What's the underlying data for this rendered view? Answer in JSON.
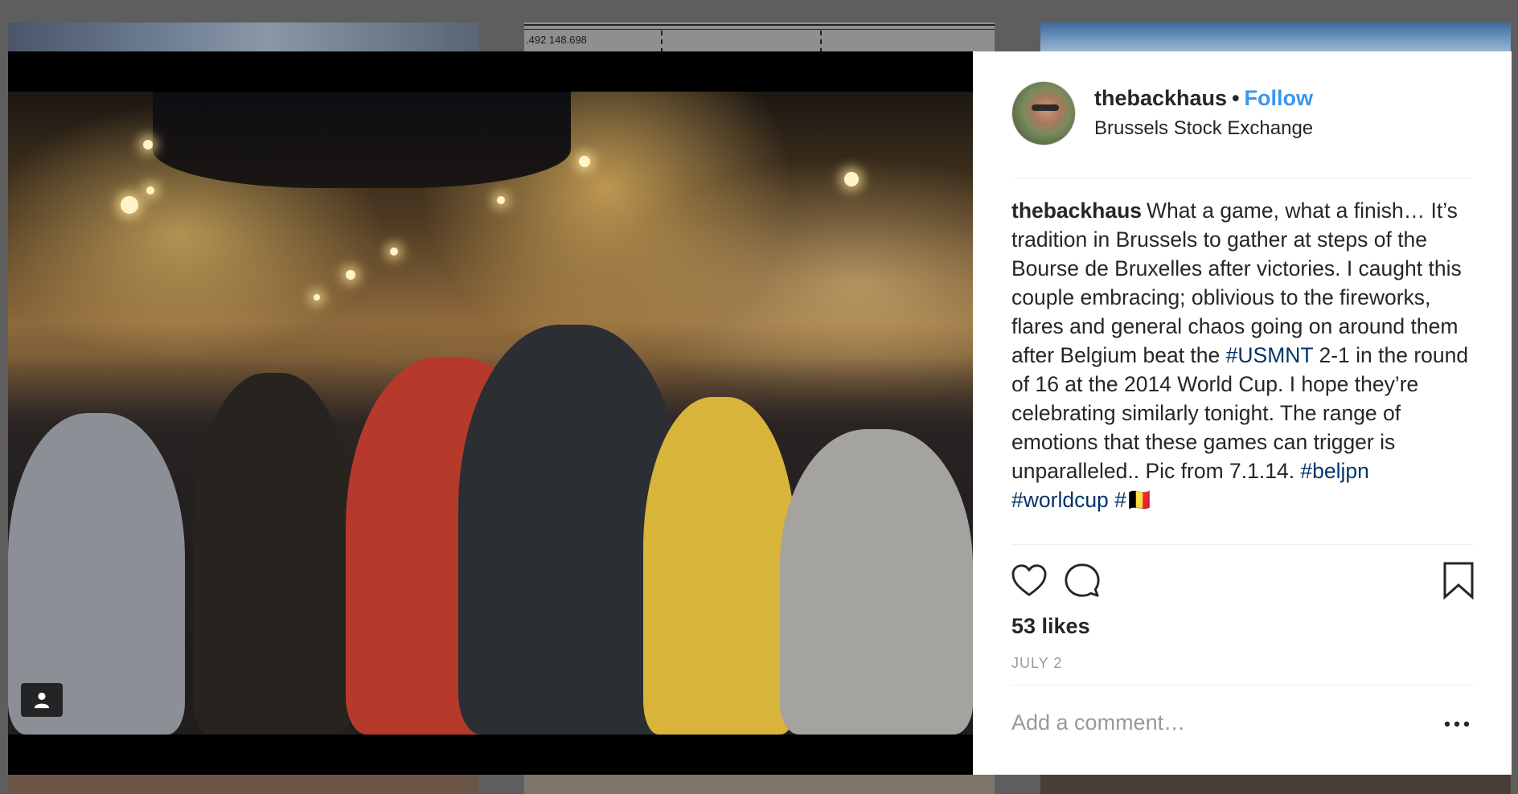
{
  "background": {
    "tile_chart_text": ".492 148.698"
  },
  "post": {
    "username": "thebackhaus",
    "separator": "•",
    "follow_label": "Follow",
    "location": "Brussels Stock Exchange",
    "caption": {
      "username": "thebackhaus",
      "text_1": "What a game, what a finish… It’s tradition in Brussels to gather at steps of the Bourse de Bruxelles after victories. I caught this couple embracing; oblivious to the fireworks, flares and general chaos going on around them after Belgium beat the ",
      "hashtag_1": "#USMNT",
      "text_2": " 2-1 in the round of 16 at the 2014 World Cup. I hope they’re celebrating similarly tonight. The range of emotions that these games can trigger is unparalleled.. Pic from 7.1.14. ",
      "hashtag_2": "#beljpn",
      "hashtag_3": "#worldcup",
      "hashtag_4": "#🇧🇪"
    },
    "likes": "53 likes",
    "date": "JULY 2",
    "comment_placeholder": "Add a comment…"
  },
  "icons": {
    "like": "heart-icon",
    "comment": "speech-bubble-icon",
    "save": "bookmark-icon",
    "more": "ellipsis-icon",
    "user_tag": "person-icon"
  },
  "colors": {
    "link_blue": "#3897f0",
    "hashtag": "#003569",
    "text": "#262626",
    "muted": "#999999"
  }
}
